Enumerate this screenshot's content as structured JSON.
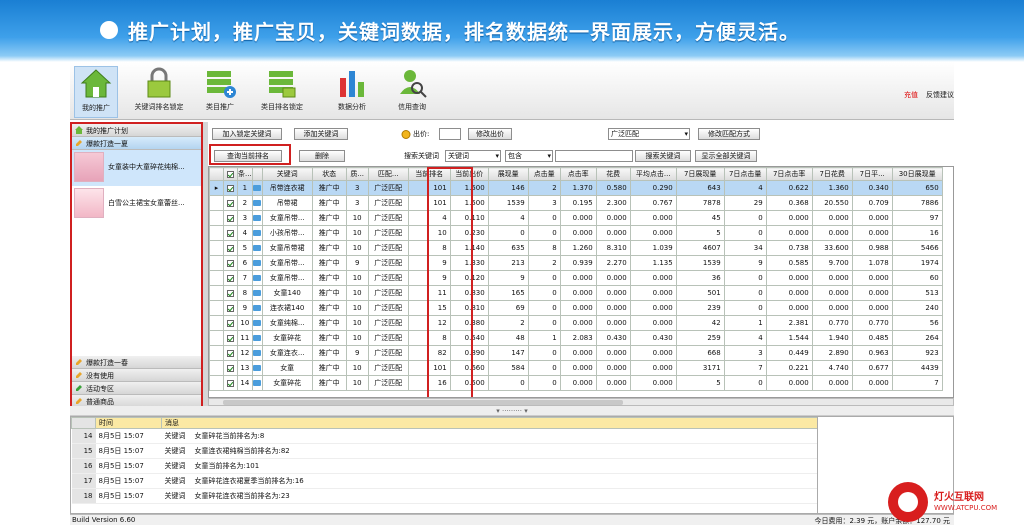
{
  "banner": {
    "title": "推广计划，推广宝贝，关键词数据，排名数据统一界面展示，方便灵活。"
  },
  "toolbar": {
    "items": [
      "我的推广",
      "关键词排名锁定",
      "类目推广",
      "类目排名锁定",
      "数据分析",
      "信用查询"
    ],
    "recharge": "充值",
    "feedback": "反馈建议"
  },
  "sidebar": {
    "plan": "我的推广计划",
    "group1": "爆款打造一夏",
    "products": [
      "女童装中大童碎花纯棉...",
      "白雪公主裙宝女童蕾丝..."
    ],
    "group2": "爆款打造一春",
    "group3": "没有使用",
    "group4": "活动专区",
    "group5": "普通商品"
  },
  "controls": {
    "add_locked": "加入锁定关键词",
    "add_keyword": "添加关键词",
    "bid_label": "出价:",
    "edit_bid": "修改出价",
    "match_select": "广泛匹配",
    "edit_match": "修改匹配方式",
    "query_rank": "查询当前排名",
    "delete": "删除",
    "search_label": "搜索关键词",
    "search_field": "关键词",
    "search_mode": "包含",
    "search_btn": "搜索关键词",
    "show_all": "显示全部关键词"
  },
  "table": {
    "headers": [
      "",
      "",
      "条...",
      "",
      "关键词",
      "状态",
      "质...",
      "匹配...",
      "当前排名",
      "当前出价",
      "展现量",
      "点击量",
      "点击率",
      "花费",
      "平均点击...",
      "7日展现量",
      "7日点击量",
      "7日点击率",
      "7日花费",
      "7日平...",
      "30日展现量"
    ],
    "rows": [
      [
        "1",
        "吊带连衣裙",
        "推广中",
        "3",
        "广泛匹配",
        "101",
        "1.500",
        "146",
        "2",
        "1.370",
        "0.580",
        "0.290",
        "643",
        "4",
        "0.622",
        "1.360",
        "0.340",
        "650"
      ],
      [
        "2",
        "吊带裙",
        "推广中",
        "3",
        "广泛匹配",
        "101",
        "1.500",
        "1539",
        "3",
        "0.195",
        "2.300",
        "0.767",
        "7878",
        "29",
        "0.368",
        "20.550",
        "0.709",
        "7886"
      ],
      [
        "3",
        "女童吊带...",
        "推广中",
        "10",
        "广泛匹配",
        "4",
        "0.110",
        "4",
        "0",
        "0.000",
        "0.000",
        "0.000",
        "45",
        "0",
        "0.000",
        "0.000",
        "0.000",
        "97"
      ],
      [
        "4",
        "小孩吊带...",
        "推广中",
        "10",
        "广泛匹配",
        "10",
        "0.230",
        "0",
        "0",
        "0.000",
        "0.000",
        "0.000",
        "5",
        "0",
        "0.000",
        "0.000",
        "0.000",
        "16"
      ],
      [
        "5",
        "女童吊带裙",
        "推广中",
        "10",
        "广泛匹配",
        "8",
        "1.140",
        "635",
        "8",
        "1.260",
        "8.310",
        "1.039",
        "4607",
        "34",
        "0.738",
        "33.600",
        "0.988",
        "5466"
      ],
      [
        "6",
        "女童吊带...",
        "推广中",
        "9",
        "广泛匹配",
        "9",
        "1.330",
        "213",
        "2",
        "0.939",
        "2.270",
        "1.135",
        "1539",
        "9",
        "0.585",
        "9.700",
        "1.078",
        "1974"
      ],
      [
        "7",
        "女童吊带...",
        "推广中",
        "10",
        "广泛匹配",
        "9",
        "0.120",
        "9",
        "0",
        "0.000",
        "0.000",
        "0.000",
        "36",
        "0",
        "0.000",
        "0.000",
        "0.000",
        "60"
      ],
      [
        "8",
        "女童140",
        "推广中",
        "10",
        "广泛匹配",
        "11",
        "0.830",
        "165",
        "0",
        "0.000",
        "0.000",
        "0.000",
        "501",
        "0",
        "0.000",
        "0.000",
        "0.000",
        "513"
      ],
      [
        "9",
        "连衣裙140",
        "推广中",
        "10",
        "广泛匹配",
        "15",
        "0.810",
        "69",
        "0",
        "0.000",
        "0.000",
        "0.000",
        "239",
        "0",
        "0.000",
        "0.000",
        "0.000",
        "240"
      ],
      [
        "10",
        "女童纯棉...",
        "推广中",
        "10",
        "广泛匹配",
        "12",
        "0.380",
        "2",
        "0",
        "0.000",
        "0.000",
        "0.000",
        "42",
        "1",
        "2.381",
        "0.770",
        "0.770",
        "56"
      ],
      [
        "11",
        "女童碎花",
        "推广中",
        "10",
        "广泛匹配",
        "8",
        "0.540",
        "48",
        "1",
        "2.083",
        "0.430",
        "0.430",
        "259",
        "4",
        "1.544",
        "1.940",
        "0.485",
        "264"
      ],
      [
        "12",
        "女童连衣...",
        "推广中",
        "9",
        "广泛匹配",
        "82",
        "0.890",
        "147",
        "0",
        "0.000",
        "0.000",
        "0.000",
        "668",
        "3",
        "0.449",
        "2.890",
        "0.963",
        "923"
      ],
      [
        "13",
        "女童",
        "推广中",
        "10",
        "广泛匹配",
        "101",
        "0.660",
        "584",
        "0",
        "0.000",
        "0.000",
        "0.000",
        "3171",
        "7",
        "0.221",
        "4.740",
        "0.677",
        "4439"
      ],
      [
        "14",
        "女童碎花",
        "推广中",
        "10",
        "广泛匹配",
        "16",
        "0.500",
        "0",
        "0",
        "0.000",
        "0.000",
        "0.000",
        "5",
        "0",
        "0.000",
        "0.000",
        "0.000",
        "7"
      ]
    ]
  },
  "log": {
    "headers": [
      "时间",
      "消息"
    ],
    "rows": [
      [
        "14",
        "8月5日  15:07",
        "关键词",
        "女童碎花当前排名为:8"
      ],
      [
        "15",
        "8月5日  15:07",
        "关键词",
        "女童连衣裙纯棉当前排名为:82"
      ],
      [
        "16",
        "8月5日  15:07",
        "关键词",
        "女童当前排名为:101"
      ],
      [
        "17",
        "8月5日  15:07",
        "关键词",
        "女童碎花连衣裙夏季当前排名为:16"
      ],
      [
        "18",
        "8月5日  15:07",
        "关键词",
        "女童碎花连衣裙当前排名为:23"
      ]
    ]
  },
  "status": {
    "build": "Build Version 6.60",
    "spend": "今日费用：2.39 元，账户余额：127.70 元"
  },
  "logo": {
    "name": "灯火互联网",
    "url": "WWW.ATCPU.COM"
  }
}
